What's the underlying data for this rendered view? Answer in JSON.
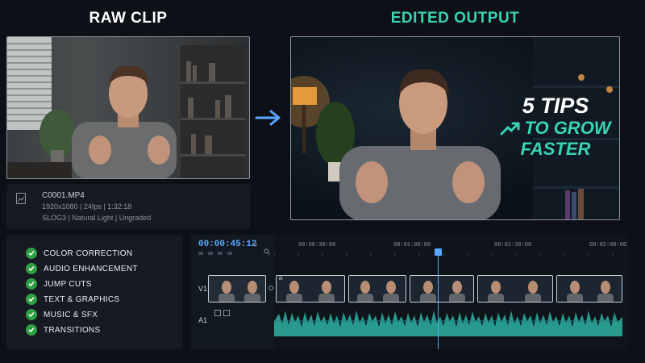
{
  "headings": {
    "raw": "RAW CLIP",
    "edited": "EDITED OUTPUT"
  },
  "overlay": {
    "line1": "5 TIPS",
    "line2": "TO GROW",
    "line3": "FASTER",
    "icon": "trending-up-icon"
  },
  "file_info": {
    "name": "C0001.MP4",
    "specs": "1920x1080 | 24fps | 1:32:18",
    "profile": "SLOG3 | Natural Light | Ungraded"
  },
  "checklist": [
    "COLOR CORRECTION",
    "AUDIO ENHANCEMENT",
    "JUMP CUTS",
    "TEXT & GRAPHICS",
    "MUSIC & SFX",
    "TRANSITIONS"
  ],
  "timeline": {
    "timecode": "00:00:45:12",
    "ruler": [
      "00:00:30:00",
      "00:01:00:00",
      "00:01:30:00",
      "00:02:00:00"
    ],
    "tracks": {
      "video": "V1",
      "audio": "A1"
    },
    "clip_badge": "fx"
  },
  "colors": {
    "accent": "#39d3b4",
    "check": "#2ea043",
    "playhead": "#58a6ff",
    "audio": "#2ba89a"
  }
}
